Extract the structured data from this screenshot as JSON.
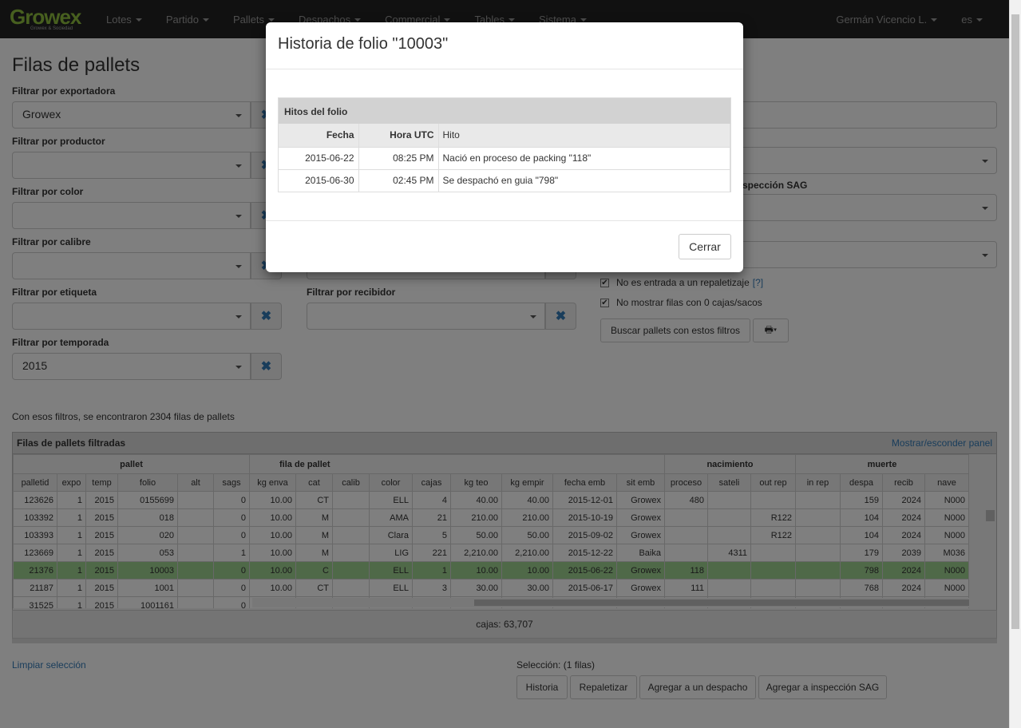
{
  "brand": {
    "logo": "Growex",
    "tagline": "Growex & Sociedad"
  },
  "nav": {
    "items": [
      "Lotes",
      "Partido",
      "Pallets",
      "Despachos",
      "Commercial",
      "Tables",
      "Sistema"
    ],
    "user": "Germán Vicencio L.",
    "lang": "es"
  },
  "page": {
    "title": "Filas de pallets"
  },
  "filters": {
    "exportadora": {
      "label": "Filtrar por exportadora",
      "value": "Growex"
    },
    "productor": {
      "label": "Filtrar por productor",
      "value": ""
    },
    "color": {
      "label": "Filtrar por color",
      "value": ""
    },
    "calibre": {
      "label": "Filtrar por calibre",
      "value": ""
    },
    "etiqueta": {
      "label": "Filtrar por etiqueta",
      "value": ""
    },
    "recibidor": {
      "label": "Filtrar por recibidor",
      "value": ""
    },
    "temporada": {
      "label": "Filtrar por temporada",
      "value": "2015"
    },
    "sag_label": "spección SAG",
    "chk_repaletizaje": "No es entrada a un repaletizaje",
    "chk_repaletizaje_help": "[?]",
    "chk_ceros": "No mostrar filas con 0 cajas/sacos",
    "search_button": "Buscar pallets con estos filtros"
  },
  "results": {
    "count_text": "Con esos filtros, se encontraron 2304 filas de pallets"
  },
  "panel": {
    "title": "Filas de pallets filtradas",
    "toggle": "Mostrar/esconder panel",
    "groups": {
      "pallet": "pallet",
      "fila": "fila de pallet",
      "nacimiento": "nacimiento",
      "muerte": "muerte"
    },
    "columns": [
      "palletid",
      "expo",
      "temp",
      "folio",
      "alt",
      "sags",
      "kg enva",
      "cat",
      "calib",
      "color",
      "cajas",
      "kg teo",
      "kg empir",
      "fecha emb",
      "sit emb",
      "proceso",
      "sateli",
      "out rep",
      "in rep",
      "despa",
      "recib",
      "nave"
    ],
    "rows": [
      [
        "123626",
        "1",
        "2015",
        "0155699",
        "",
        "0",
        "10.00",
        "CT",
        "",
        "ELL",
        "4",
        "40.00",
        "40.00",
        "2015-12-01",
        "Growex",
        "480",
        "",
        "",
        "",
        "159",
        "2024",
        "N000"
      ],
      [
        "103392",
        "1",
        "2015",
        "018",
        "",
        "0",
        "10.00",
        "M",
        "",
        "AMA",
        "21",
        "210.00",
        "210.00",
        "2015-10-19",
        "Growex",
        "",
        "",
        "R122",
        "",
        "104",
        "2024",
        "N000"
      ],
      [
        "103393",
        "1",
        "2015",
        "020",
        "",
        "0",
        "10.00",
        "M",
        "",
        "Clara",
        "5",
        "50.00",
        "50.00",
        "2015-09-02",
        "Growex",
        "",
        "",
        "R122",
        "",
        "104",
        "2024",
        "N000"
      ],
      [
        "123669",
        "1",
        "2015",
        "053",
        "",
        "1",
        "10.00",
        "M",
        "",
        "LIG",
        "221",
        "2,210.00",
        "2,210.00",
        "2015-12-22",
        "Baika",
        "",
        "4311",
        "",
        "",
        "179",
        "2039",
        "M036"
      ],
      [
        "21376",
        "1",
        "2015",
        "10003",
        "",
        "0",
        "10.00",
        "C",
        "",
        "ELL",
        "1",
        "10.00",
        "10.00",
        "2015-06-22",
        "Growex",
        "118",
        "",
        "",
        "",
        "798",
        "2024",
        "N000"
      ],
      [
        "21187",
        "1",
        "2015",
        "1001",
        "",
        "0",
        "10.00",
        "CT",
        "",
        "ELL",
        "3",
        "30.00",
        "30.00",
        "2015-06-17",
        "Growex",
        "111",
        "",
        "",
        "",
        "768",
        "2024",
        "N000"
      ],
      [
        "31525",
        "1",
        "2015",
        "1001161",
        "",
        "0",
        "",
        "",
        "",
        "",
        "",
        "",
        "",
        "",
        "",
        "",
        "",
        "",
        "",
        "",
        "",
        ""
      ]
    ],
    "total": "cajas: 63,707"
  },
  "selection": {
    "clear": "Limpiar selección",
    "label": "Selección: (1 filas)",
    "buttons": [
      "Historia",
      "Repaletizar",
      "Agregar a un despacho",
      "Agregar a inspección SAG"
    ]
  },
  "modal": {
    "title": "Historia de folio \"10003\"",
    "table_title": "Hitos del folio",
    "headers": [
      "Fecha",
      "Hora UTC",
      "Hito"
    ],
    "rows": [
      [
        "2015-06-22",
        "08:25 PM",
        "Nació en proceso de packing \"118\""
      ],
      [
        "2015-06-30",
        "02:45 PM",
        "Se despachó en guia \"798\""
      ]
    ],
    "close": "Cerrar"
  }
}
